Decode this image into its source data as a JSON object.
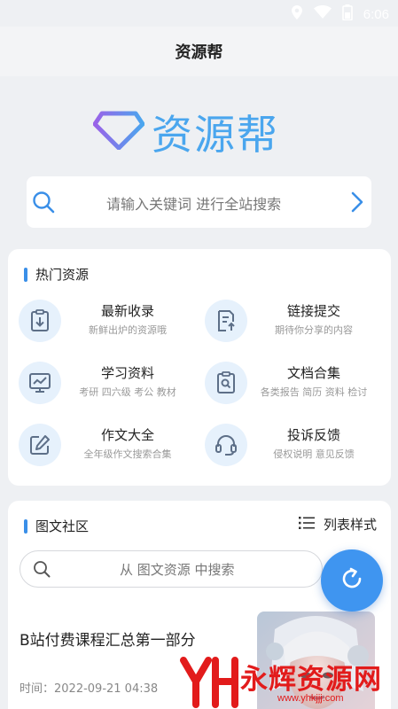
{
  "status_bar": {
    "time": "6:06",
    "icons": [
      "location-icon",
      "wifi-icon",
      "battery-icon"
    ]
  },
  "header": {
    "title": "资源帮"
  },
  "logo": {
    "text": "资源帮",
    "icon": "diamond-icon"
  },
  "search": {
    "placeholder": "请输入关键词 进行全站搜索"
  },
  "hot_resources": {
    "title": "热门资源",
    "items": [
      {
        "title": "最新收录",
        "subtitle": "新鲜出炉的资源哦",
        "icon": "clipboard-download-icon"
      },
      {
        "title": "链接提交",
        "subtitle": "期待你分享的内容",
        "icon": "document-upload-icon"
      },
      {
        "title": "学习资料",
        "subtitle": "考研 四六级 考公 教材",
        "icon": "chart-board-icon"
      },
      {
        "title": "文档合集",
        "subtitle": "各类报告 简历 资料 检讨",
        "icon": "document-search-icon"
      },
      {
        "title": "作文大全",
        "subtitle": "全年级作文搜索合集",
        "icon": "edit-icon"
      },
      {
        "title": "投诉反馈",
        "subtitle": "侵权说明 意见反馈",
        "icon": "headset-icon"
      }
    ]
  },
  "community": {
    "title": "图文社区",
    "layout_toggle_label": "列表样式",
    "search_placeholder": "从 图文资源 中搜索",
    "post": {
      "title": "B站付费课程汇总第一部分",
      "time": "时间：2022-09-21 04:38"
    }
  },
  "watermark": {
    "text": "永辉资源网",
    "url": "www.yhkjjj.com"
  },
  "colors": {
    "accent": "#3f95f0",
    "logo_blue": "#4aa6ee",
    "watermark_red": "#e21b1b"
  }
}
